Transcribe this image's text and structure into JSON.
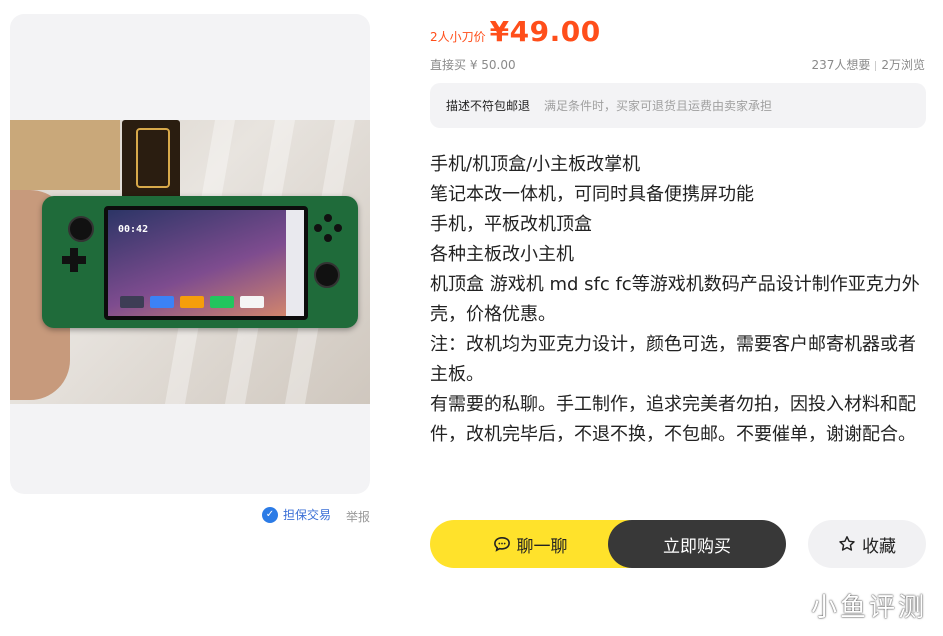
{
  "price": {
    "prefix": "2人小刀价",
    "currency": "¥",
    "value": "49.00",
    "direct_buy": "直接买  ¥ 50.00",
    "wants": "237人想要",
    "views": "2万浏览"
  },
  "policy": {
    "tag": "描述不符包邮退",
    "desc": "满足条件时，买家可退货且运费由卖家承担"
  },
  "description": [
    "手机/机顶盒/小主板改掌机",
    "笔记本改一体机，可同时具备便携屏功能",
    "手机，平板改机顶盒",
    "各种主板改小主机",
    "机顶盒 游戏机 md sfc fc等游戏机数码产品设计制作亚克力外壳，价格优惠。",
    "注：改机均为亚克力设计，颜色可选，需要客户邮寄机器或者主板。",
    "有需要的私聊。手工制作，追求完美者勿拍，因投入材料和配件，改机完毕后，不退不换，不包邮。不要催单，谢谢配合。"
  ],
  "photo": {
    "screen_time": "00:42"
  },
  "footer_links": {
    "guarantee": "担保交易",
    "report": "举报"
  },
  "actions": {
    "chat": "聊一聊",
    "buy": "立即购买",
    "favorite": "收藏"
  },
  "watermark": "小鱼评测",
  "colors": {
    "price_accent": "#ff4e1a",
    "chat_button": "#ffe22b",
    "buy_button": "#383838",
    "guarantee_blue": "#2b7be6"
  }
}
